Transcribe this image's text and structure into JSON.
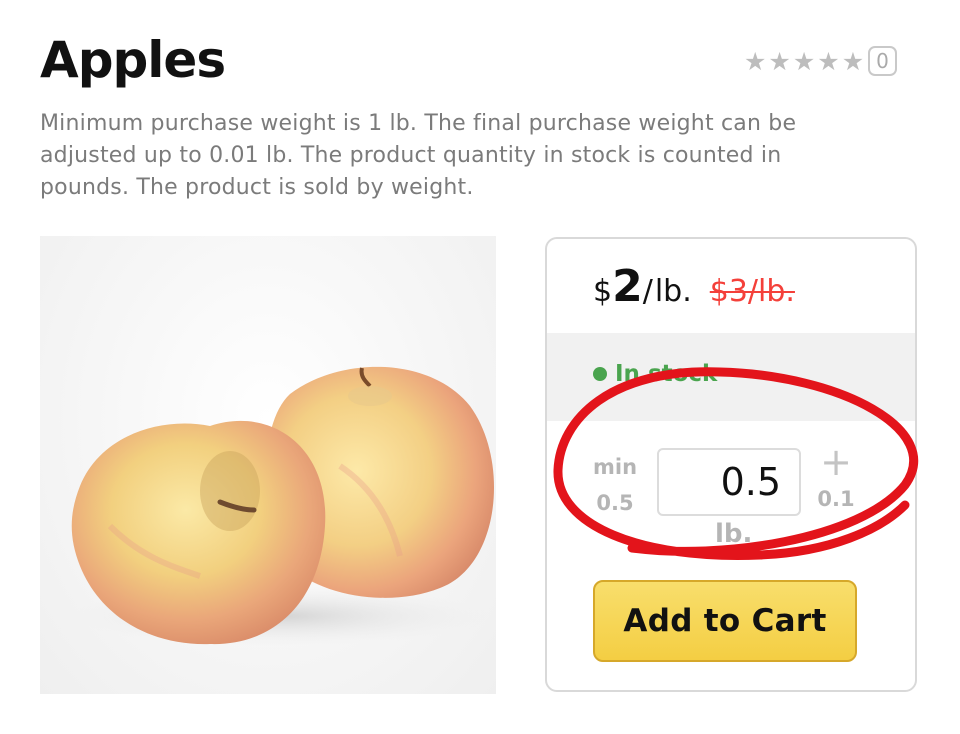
{
  "product": {
    "title": "Apples",
    "description": "Minimum purchase weight is 1 lb. The final purchase weight can be adjusted up to 0.01 lb.  The product quantity in stock is counted in pounds. The product is sold by weight.",
    "rating": {
      "stars": 0,
      "max_stars": 5,
      "count": "0",
      "star_icon": "star-icon"
    }
  },
  "pricing": {
    "currency": "$",
    "current_amount": "2",
    "unit_separator": "/",
    "unit": "lb.",
    "old_price": "$3/lb.",
    "old_price_color": "#f4403a"
  },
  "stock": {
    "label": "In stock",
    "color": "#4aa44e"
  },
  "quantity": {
    "min_label": "min",
    "min_value": "0.5",
    "value": "0.5",
    "unit": "lb.",
    "plus_symbol": "+",
    "step": "0.1"
  },
  "cart": {
    "add_label": "Add to Cart",
    "button_color": "#f6d455"
  },
  "annotation": {
    "color": "#e3141b",
    "shape": "hand-drawn-ellipse"
  }
}
